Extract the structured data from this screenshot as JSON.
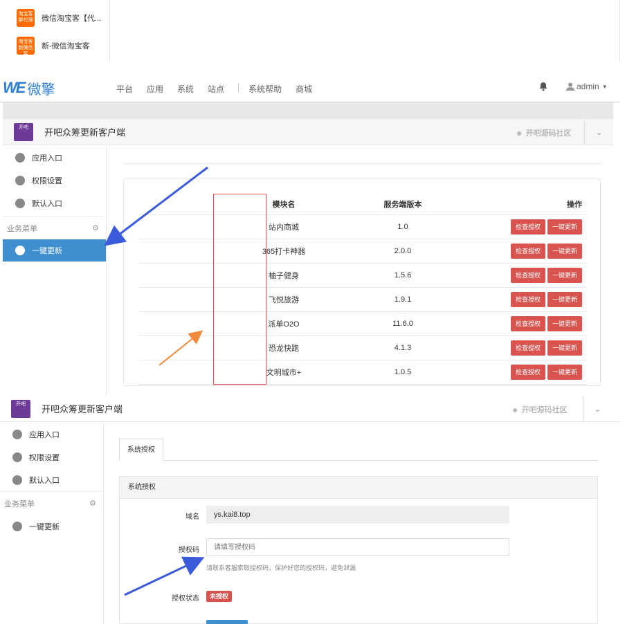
{
  "top_apps": [
    {
      "icon_text": "淘宝客\n群代理",
      "name": "微信淘宝客【代..."
    },
    {
      "icon_text": "淘宝客\n新微信客",
      "name": "新-微信淘宝客"
    }
  ],
  "header": {
    "logo_mark": "WE",
    "logo_text": "微擎",
    "nav": [
      "平台",
      "应用",
      "系统",
      "站点",
      "系统帮助",
      "商城"
    ],
    "user": "admin"
  },
  "app": {
    "icon_text": "开吧",
    "title": "开吧众筹更新客户端",
    "community": "开吧源码社区"
  },
  "sidebar": {
    "items": [
      "应用入口",
      "权限设置",
      "默认入口"
    ],
    "section": "业务菜单",
    "active": "一键更新"
  },
  "table": {
    "headers": [
      "模块名",
      "服务端版本",
      "操作"
    ],
    "rows": [
      {
        "name": "站内商城",
        "version": "1.0"
      },
      {
        "name": "365打卡神器",
        "version": "2.0.0"
      },
      {
        "name": "柚子健身",
        "version": "1.5.6"
      },
      {
        "name": "飞悦旅游",
        "version": "1.9.1"
      },
      {
        "name": "派单O2O",
        "version": "11.6.0"
      },
      {
        "name": "恐龙快跑",
        "version": "4.1.3"
      },
      {
        "name": "文明城市+",
        "version": "1.0.5"
      }
    ],
    "btn_check": "检查授权",
    "btn_update": "一键更新"
  },
  "auth": {
    "tab": "系统授权",
    "panel_title": "系统授权",
    "domain_label": "域名",
    "domain_value": "ys.kai8.top",
    "code_label": "授权码",
    "code_placeholder": "请填写授权码",
    "hint": "请联系客服索取授权码，保护好您的授权码，避免泄漏",
    "status_label": "授权状态",
    "status_value": "未授权"
  },
  "colors": {
    "accent": "#3e8ed0",
    "danger": "#d9534f",
    "arrow_blue": "#3b5bdb",
    "arrow_orange": "#f08a3c"
  }
}
